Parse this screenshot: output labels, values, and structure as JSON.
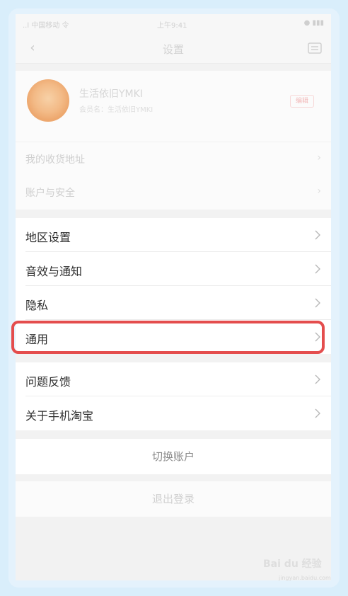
{
  "status_bar": {
    "carrier": "..l 中国移动 令",
    "time": "上午9:41",
    "right": "● ▮▮▮"
  },
  "nav": {
    "title": "设置"
  },
  "profile": {
    "name": "生活依旧YMKI",
    "subtitle": "会员名：生活依旧YMKI",
    "tag": "编辑"
  },
  "rows": {
    "address": "我的收货地址",
    "account_security": "账户与安全",
    "region": "地区设置",
    "sound_notify": "音效与通知",
    "privacy": "隐私",
    "general": "通用",
    "feedback": "问题反馈",
    "about": "关于手机淘宝"
  },
  "actions": {
    "switch_account": "切换账户",
    "logout": "退出登录"
  },
  "watermark": {
    "brand": "Bai du 经验",
    "url": "jingyan.baidu.com"
  },
  "colors": {
    "highlight": "#e44d4d",
    "background": "#f2f2f2",
    "frame": "#d9eefb"
  }
}
